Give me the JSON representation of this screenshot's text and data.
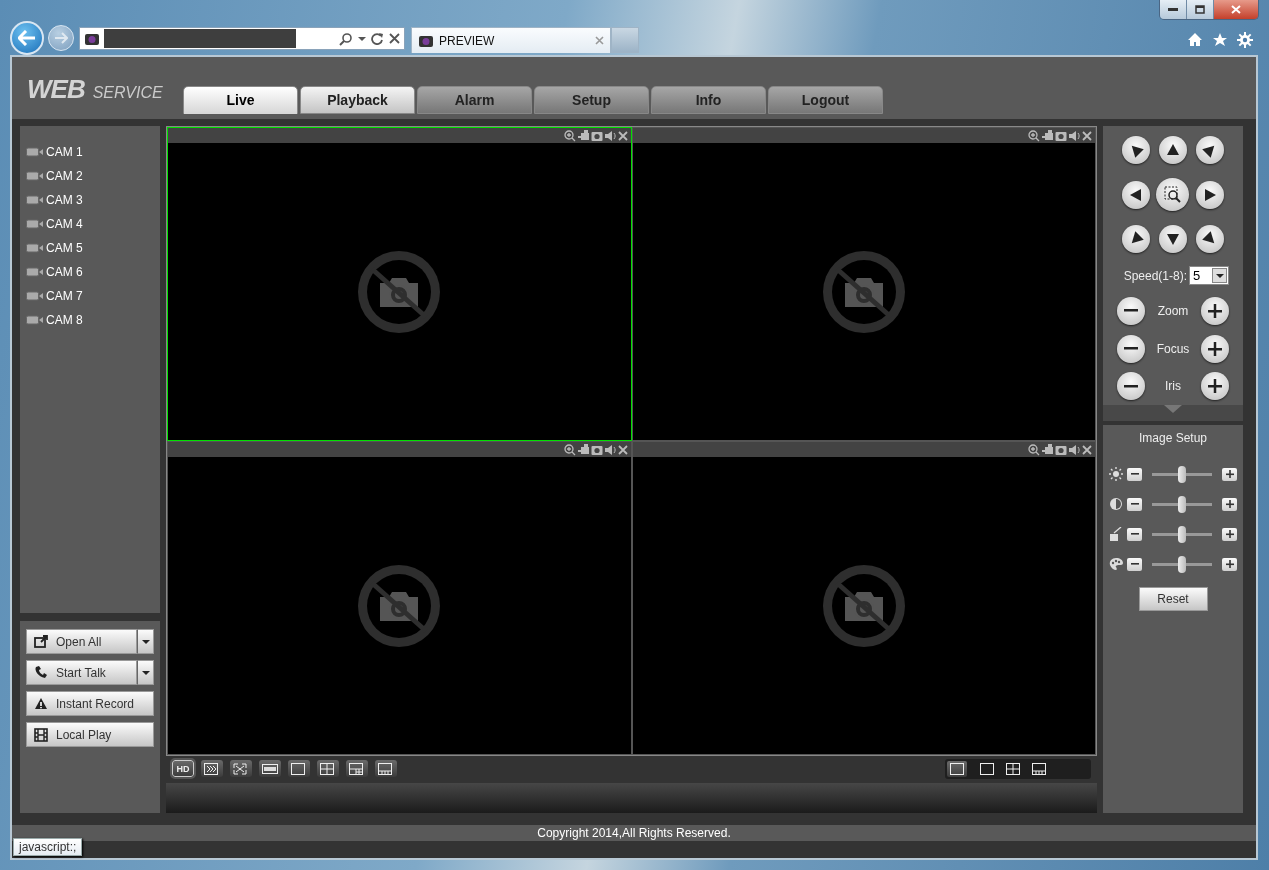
{
  "browser": {
    "tab_title": "PREVIEW",
    "status_tooltip": "javascript:;"
  },
  "header": {
    "logo_bold": "WEB",
    "logo_light": "SERVICE",
    "tabs": [
      {
        "label": "Live",
        "selected": true,
        "hovered": false
      },
      {
        "label": "Playback",
        "selected": false,
        "hovered": true
      },
      {
        "label": "Alarm",
        "selected": false,
        "hovered": false
      },
      {
        "label": "Setup",
        "selected": false,
        "hovered": false
      },
      {
        "label": "Info",
        "selected": false,
        "hovered": false
      },
      {
        "label": "Logout",
        "selected": false,
        "hovered": false
      }
    ]
  },
  "cameras": [
    "CAM 1",
    "CAM 2",
    "CAM 3",
    "CAM 4",
    "CAM 5",
    "CAM 6",
    "CAM 7",
    "CAM 8"
  ],
  "actions": [
    {
      "label": "Open All",
      "dropdown": true
    },
    {
      "label": "Start Talk",
      "dropdown": true
    },
    {
      "label": "Instant Record",
      "dropdown": false
    },
    {
      "label": "Local Play",
      "dropdown": false
    }
  ],
  "panes": [
    {
      "selected": true
    },
    {
      "selected": false
    },
    {
      "selected": false
    },
    {
      "selected": false
    }
  ],
  "toolbar": {
    "quality_label": "HD"
  },
  "ptz": {
    "speed_label": "Speed(1-8):",
    "speed_value": "5",
    "lens": [
      "Zoom",
      "Focus",
      "Iris"
    ]
  },
  "image_setup": {
    "title": "Image Setup",
    "sliders": [
      {
        "level": 0.5
      },
      {
        "level": 0.5
      },
      {
        "level": 0.5
      },
      {
        "level": 0.5
      }
    ],
    "reset": "Reset"
  },
  "footer": {
    "copyright": "Copyright 2014,All Rights Reserved."
  }
}
